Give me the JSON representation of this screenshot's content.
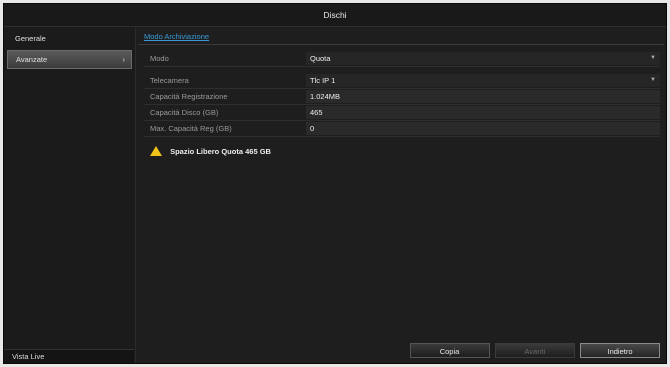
{
  "window": {
    "title": "Dischi"
  },
  "sidebar": {
    "items": [
      {
        "label": "Generale"
      },
      {
        "label": "Avanzate",
        "chevron": "›"
      }
    ],
    "bottom_label": "Vista Live"
  },
  "main": {
    "tab_label": "Modo Archiviazione",
    "fields": [
      {
        "label": "Modo",
        "value": "Quota",
        "type": "select"
      },
      {
        "label": "Telecamera",
        "value": "Tlc IP 1",
        "type": "select"
      },
      {
        "label": "Capacità Registrazione",
        "value": "1.024MB",
        "type": "text"
      },
      {
        "label": "Capacità Disco (GB)",
        "value": "465",
        "type": "text"
      },
      {
        "label": "Max. Capacità Reg (GB)",
        "value": "0",
        "type": "input"
      }
    ],
    "warning": {
      "icon": "warning-icon",
      "text": "Spazio Libero Quota 465 GB",
      "color": "#f0c419"
    }
  },
  "buttons": {
    "copy": "Copia",
    "next": "Avanti",
    "back": "Indietro"
  }
}
